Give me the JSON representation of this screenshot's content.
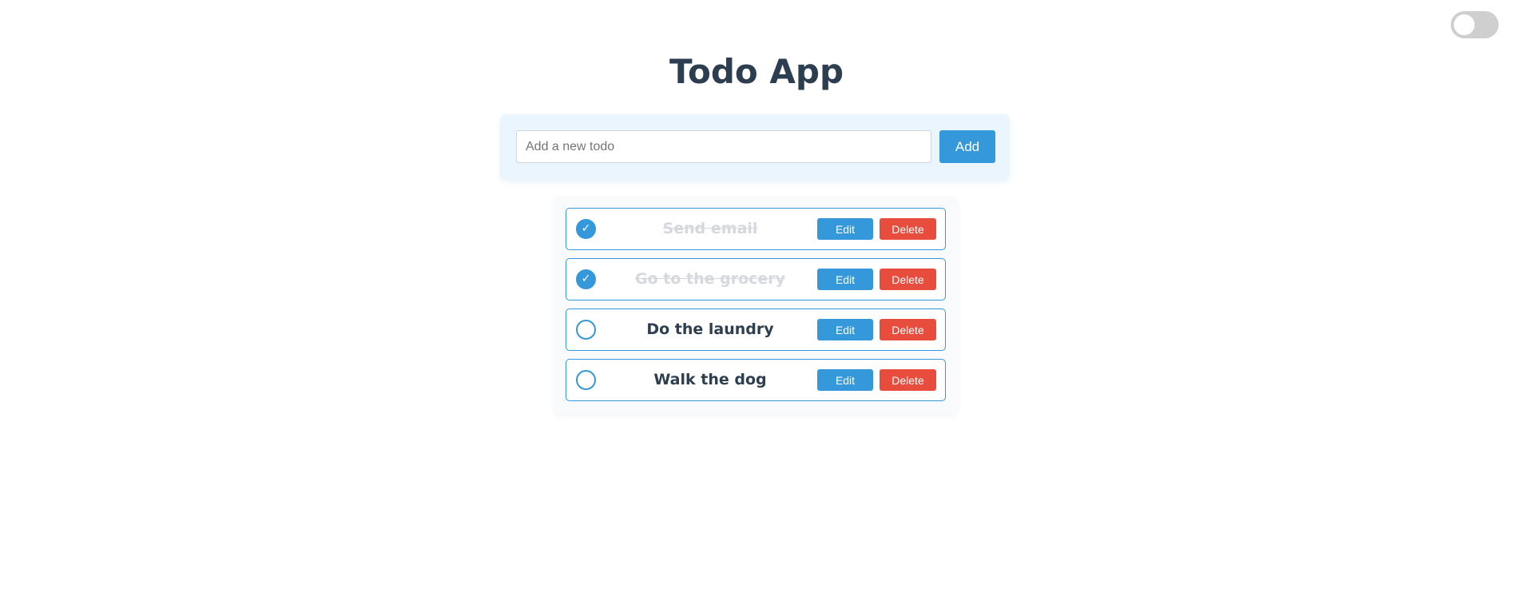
{
  "header": {
    "title": "Todo App"
  },
  "theme_toggle": {
    "state": "off"
  },
  "add_form": {
    "placeholder": "Add a new todo",
    "value": "",
    "add_label": "Add"
  },
  "todos": [
    {
      "text": "Send email",
      "completed": true,
      "check_glyph": "✓",
      "edit_label": "Edit",
      "delete_label": "Delete"
    },
    {
      "text": "Go to the grocery",
      "completed": true,
      "check_glyph": "✓",
      "edit_label": "Edit",
      "delete_label": "Delete"
    },
    {
      "text": "Do the laundry",
      "completed": false,
      "check_glyph": "",
      "edit_label": "Edit",
      "delete_label": "Delete"
    },
    {
      "text": "Walk the dog",
      "completed": false,
      "check_glyph": "",
      "edit_label": "Edit",
      "delete_label": "Delete"
    }
  ],
  "colors": {
    "accent": "#3498db",
    "danger": "#e74c3c",
    "title": "#2c3e50",
    "completed_text": "#d5d8dc"
  }
}
